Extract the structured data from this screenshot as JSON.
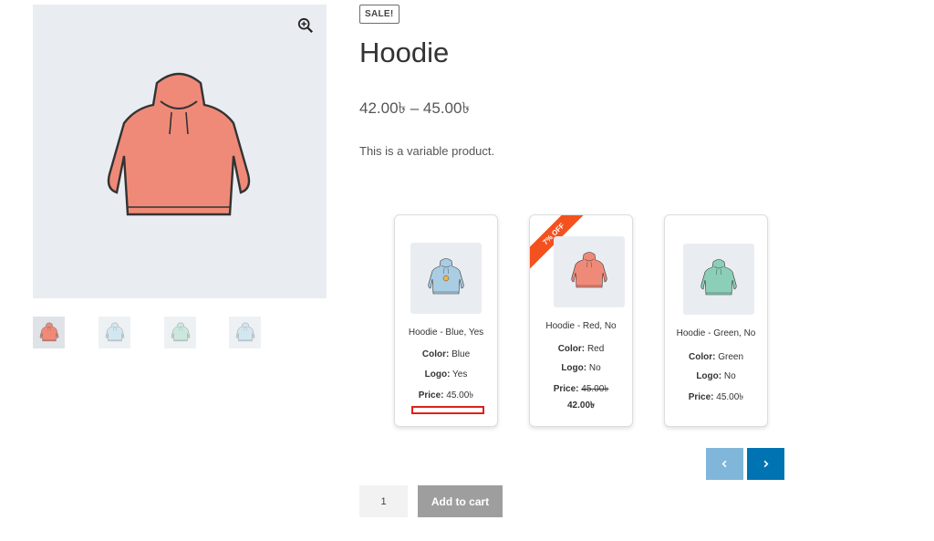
{
  "badge": "SALE!",
  "product": {
    "title": "Hoodie",
    "price_range": "42.00৳ – 45.00৳",
    "description": "This is a variable product."
  },
  "gallery": {
    "main_icon": "hoodie-red",
    "zoom_icon": "zoom-in-icon",
    "thumbnails": [
      "hoodie-red",
      "hoodie-blue-logo",
      "hoodie-green",
      "hoodie-blue"
    ]
  },
  "variations": [
    {
      "name": "Hoodie - Blue, Yes",
      "color_label": "Color:",
      "color": "Blue",
      "logo_label": "Logo:",
      "logo": "Yes",
      "price_label": "Price:",
      "price": "45.00৳",
      "image": "hoodie-blue-logo"
    },
    {
      "name": "Hoodie - Red, No",
      "color_label": "Color:",
      "color": "Red",
      "logo_label": "Logo:",
      "logo": "No",
      "price_label": "Price:",
      "price_old": "45.00৳",
      "price": "42.00৳",
      "ribbon": "7% OFF",
      "image": "hoodie-red"
    },
    {
      "name": "Hoodie - Green, No",
      "color_label": "Color:",
      "color": "Green",
      "logo_label": "Logo:",
      "logo": "No",
      "price_label": "Price:",
      "price": "45.00৳",
      "image": "hoodie-green"
    }
  ],
  "carousel": {
    "prev": "‹",
    "next": "›"
  },
  "cart": {
    "quantity": "1",
    "button": "Add to cart"
  },
  "colors": {
    "sale_ribbon": "#f4511e",
    "nav_active": "#0073b3",
    "nav_inactive": "#7fb6d9",
    "highlight_box": "#e0201b",
    "hoodie_red": "#f08a78",
    "hoodie_blue": "#a9cde3",
    "hoodie_green": "#8ccfb8"
  }
}
